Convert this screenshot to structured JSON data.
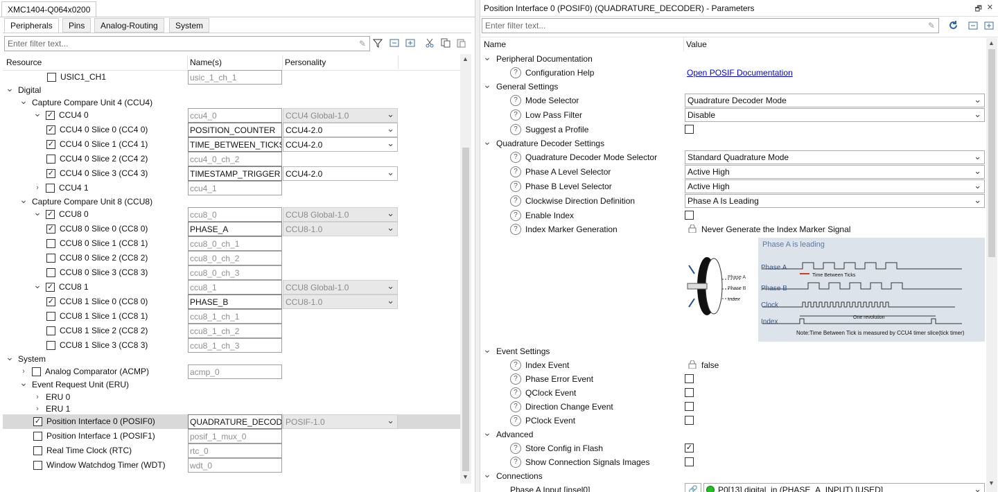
{
  "left": {
    "editor_tab": "XMC1404-Q064x0200",
    "tabs": [
      "Peripherals",
      "Pins",
      "Analog-Routing",
      "System"
    ],
    "filter_placeholder": "Enter filter text...",
    "columns": {
      "resource": "Resource",
      "names": "Name(s)",
      "personality": "Personality"
    },
    "rows": [
      {
        "indent": 0,
        "arrow": "",
        "cb": "unchecked",
        "label": "USIC1_CH1",
        "name": "usic_1_ch_1",
        "name_gray": true,
        "combo": "",
        "combo_dis": false
      },
      {
        "indent": 0,
        "arrow": "down",
        "cb": "none",
        "label": "Digital",
        "name": "",
        "combo": ""
      },
      {
        "indent": 1,
        "arrow": "down",
        "cb": "none",
        "label": "Capture Compare Unit 4 (CCU4)",
        "name": "",
        "combo": ""
      },
      {
        "indent": 2,
        "arrow": "down",
        "cb": "checked",
        "label": "CCU4 0",
        "name": "ccu4_0",
        "name_gray": true,
        "combo": "CCU4 Global-1.0",
        "combo_dis": true
      },
      {
        "indent": 3,
        "arrow": "",
        "cb": "checked",
        "label": "CCU4 0 Slice 0 (CC4 0)",
        "name": "POSITION_COUNTER",
        "name_gray": false,
        "combo": "CCU4-2.0",
        "combo_dis": false
      },
      {
        "indent": 3,
        "arrow": "",
        "cb": "checked",
        "label": "CCU4 0 Slice 1 (CC4 1)",
        "name": "TIME_BETWEEN_TICKS",
        "name_gray": false,
        "combo": "CCU4-2.0",
        "combo_dis": false
      },
      {
        "indent": 3,
        "arrow": "",
        "cb": "unchecked",
        "label": "CCU4 0 Slice 2 (CC4 2)",
        "name": "ccu4_0_ch_2",
        "name_gray": true,
        "combo": ""
      },
      {
        "indent": 3,
        "arrow": "",
        "cb": "checked",
        "label": "CCU4 0 Slice 3 (CC4 3)",
        "name": "TIMESTAMP_TRIGGER",
        "name_gray": false,
        "combo": "CCU4-2.0",
        "combo_dis": false
      },
      {
        "indent": 2,
        "arrow": "right",
        "cb": "unchecked",
        "label": "CCU4 1",
        "name": "ccu4_1",
        "name_gray": true,
        "combo": ""
      },
      {
        "indent": 1,
        "arrow": "down",
        "cb": "none",
        "label": "Capture Compare Unit 8 (CCU8)",
        "name": "",
        "combo": ""
      },
      {
        "indent": 2,
        "arrow": "down",
        "cb": "checked",
        "label": "CCU8 0",
        "name": "ccu8_0",
        "name_gray": true,
        "combo": "CCU8 Global-1.0",
        "combo_dis": true
      },
      {
        "indent": 3,
        "arrow": "",
        "cb": "checked",
        "label": "CCU8 0 Slice 0 (CC8 0)",
        "name": "PHASE_A",
        "name_gray": false,
        "combo": "CCU8-1.0",
        "combo_dis": true
      },
      {
        "indent": 3,
        "arrow": "",
        "cb": "unchecked",
        "label": "CCU8 0 Slice 1 (CC8 1)",
        "name": "ccu8_0_ch_1",
        "name_gray": true,
        "combo": ""
      },
      {
        "indent": 3,
        "arrow": "",
        "cb": "unchecked",
        "label": "CCU8 0 Slice 2 (CC8 2)",
        "name": "ccu8_0_ch_2",
        "name_gray": true,
        "combo": ""
      },
      {
        "indent": 3,
        "arrow": "",
        "cb": "unchecked",
        "label": "CCU8 0 Slice 3 (CC8 3)",
        "name": "ccu8_0_ch_3",
        "name_gray": true,
        "combo": ""
      },
      {
        "indent": 2,
        "arrow": "down",
        "cb": "checked",
        "label": "CCU8 1",
        "name": "ccu8_1",
        "name_gray": true,
        "combo": "CCU8 Global-1.0",
        "combo_dis": true
      },
      {
        "indent": 3,
        "arrow": "",
        "cb": "checked",
        "label": "CCU8 1 Slice 0 (CC8 0)",
        "name": "PHASE_B",
        "name_gray": false,
        "combo": "CCU8-1.0",
        "combo_dis": true
      },
      {
        "indent": 3,
        "arrow": "",
        "cb": "unchecked",
        "label": "CCU8 1 Slice 1 (CC8 1)",
        "name": "ccu8_1_ch_1",
        "name_gray": true,
        "combo": ""
      },
      {
        "indent": 3,
        "arrow": "",
        "cb": "unchecked",
        "label": "CCU8 1 Slice 2 (CC8 2)",
        "name": "ccu8_1_ch_2",
        "name_gray": true,
        "combo": ""
      },
      {
        "indent": 3,
        "arrow": "",
        "cb": "unchecked",
        "label": "CCU8 1 Slice 3 (CC8 3)",
        "name": "ccu8_1_ch_3",
        "name_gray": true,
        "combo": ""
      },
      {
        "indent": 0,
        "arrow": "down",
        "cb": "none",
        "label": "System",
        "name": "",
        "combo": ""
      },
      {
        "indent": 1,
        "arrow": "right",
        "cb": "unchecked",
        "label": "Analog Comparator (ACMP)",
        "name": "acmp_0",
        "name_gray": true,
        "combo": ""
      },
      {
        "indent": 1,
        "arrow": "down",
        "cb": "none",
        "label": "Event Request Unit (ERU)",
        "name": "",
        "combo": ""
      },
      {
        "indent": 2,
        "arrow": "right",
        "cb": "none",
        "label": "ERU 0",
        "name": "",
        "combo": ""
      },
      {
        "indent": 2,
        "arrow": "right",
        "cb": "none",
        "label": "ERU 1",
        "name": "",
        "combo": ""
      },
      {
        "indent": 1,
        "arrow": "",
        "cb": "checked",
        "label": "Position Interface 0 (POSIF0)",
        "name": "QUADRATURE_DECODER",
        "name_gray": false,
        "combo": "POSIF-1.0",
        "combo_dis": true,
        "selected": true
      },
      {
        "indent": 1,
        "arrow": "",
        "cb": "unchecked",
        "label": "Position Interface 1 (POSIF1)",
        "name": "posif_1_mux_0",
        "name_gray": true,
        "combo": ""
      },
      {
        "indent": 1,
        "arrow": "",
        "cb": "unchecked",
        "label": "Real Time Clock (RTC)",
        "name": "rtc_0",
        "name_gray": true,
        "combo": ""
      },
      {
        "indent": 1,
        "arrow": "",
        "cb": "unchecked",
        "label": "Window Watchdog Timer (WDT)",
        "name": "wdt_0",
        "name_gray": true,
        "combo": ""
      }
    ]
  },
  "right": {
    "title": "Position Interface 0 (POSIF0) (QUADRATURE_DECODER) - Parameters",
    "filter_placeholder": "Enter filter text...",
    "columns": {
      "name": "Name",
      "value": "Value"
    },
    "rows": [
      {
        "kind": "group",
        "label": "Peripheral Documentation"
      },
      {
        "kind": "link",
        "label": "Configuration Help",
        "value": "Open POSIF Documentation"
      },
      {
        "kind": "group",
        "label": "General Settings"
      },
      {
        "kind": "combo",
        "label": "Mode Selector",
        "value": "Quadrature Decoder Mode"
      },
      {
        "kind": "combo",
        "label": "Low Pass Filter",
        "value": "Disable"
      },
      {
        "kind": "check",
        "label": "Suggest a Profile",
        "checked": false
      },
      {
        "kind": "group",
        "label": "Quadrature Decoder Settings"
      },
      {
        "kind": "combo",
        "label": "Quadrature Decoder Mode Selector",
        "value": "Standard Quadrature Mode"
      },
      {
        "kind": "combo",
        "label": "Phase A Level Selector",
        "value": "Active High"
      },
      {
        "kind": "combo",
        "label": "Phase B Level Selector",
        "value": "Active High"
      },
      {
        "kind": "combo",
        "label": "Clockwise Direction Definition",
        "value": "Phase A Is Leading"
      },
      {
        "kind": "check",
        "label": "Enable Index",
        "checked": false
      },
      {
        "kind": "locked",
        "label": "Index Marker Generation",
        "value": "Never Generate the Index Marker Signal"
      },
      {
        "kind": "image"
      },
      {
        "kind": "group",
        "label": "Event Settings"
      },
      {
        "kind": "locked",
        "label": "Index Event",
        "value": "false"
      },
      {
        "kind": "check",
        "label": "Phase Error Event",
        "checked": false
      },
      {
        "kind": "check",
        "label": "QClock Event",
        "checked": false
      },
      {
        "kind": "check",
        "label": "Direction Change Event",
        "checked": false
      },
      {
        "kind": "check",
        "label": "PClock Event",
        "checked": false
      },
      {
        "kind": "group",
        "label": "Advanced"
      },
      {
        "kind": "check",
        "label": "Store Config in Flash",
        "checked": true
      },
      {
        "kind": "check",
        "label": "Show Connection Signals Images",
        "checked": false
      },
      {
        "kind": "group",
        "label": "Connections"
      },
      {
        "kind": "conn",
        "label": "Phase A Input [insel0]",
        "value": "P0[13] digital_in (PHASE_A_INPUT) [USED]"
      }
    ],
    "diagram": {
      "title": "Phase A is leading",
      "signals": [
        "Phase A",
        "Phase B",
        "Clock",
        "Index"
      ],
      "encoder_labels": [
        "Phase A",
        "Phase B",
        "Index"
      ],
      "annot_tick": "Time Between Ticks",
      "annot_rev": "One revolution",
      "note": "Note:Time Between Tick is measured by CCU4 timer slice(tick timer)"
    }
  },
  "colors": {
    "link": "#0000ee",
    "selected_row": "#d9d9d9",
    "status_green": "#22c022"
  }
}
